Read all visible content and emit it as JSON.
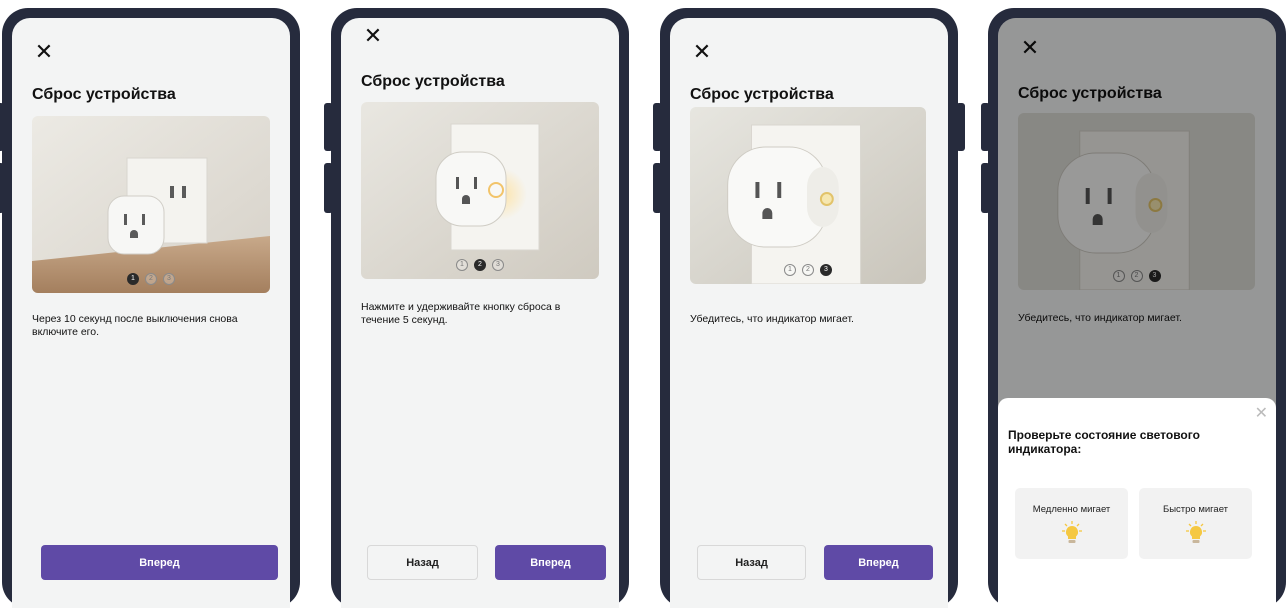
{
  "close_glyph": "✕",
  "sheet_close_glyph": "✕",
  "screens": [
    {
      "title": "Сброс устройства",
      "dots": [
        "1",
        "2",
        "3"
      ],
      "active_dot": 1,
      "description": "Через 10 секунд после выключения снова включите его.",
      "next_label": "Вперед"
    },
    {
      "title": "Сброс устройства",
      "dots": [
        "1",
        "2",
        "3"
      ],
      "active_dot": 2,
      "description": "Нажмите и удерживайте кнопку сброса в течение 5 секунд.",
      "back_label": "Назад",
      "next_label": "Вперед"
    },
    {
      "title": "Сброс устройства",
      "dots": [
        "1",
        "2",
        "3"
      ],
      "active_dot": 3,
      "description": "Убедитесь, что индикатор мигает.",
      "back_label": "Назад",
      "next_label": "Вперед"
    },
    {
      "title": "Сброс устройства",
      "dots": [
        "1",
        "2",
        "3"
      ],
      "active_dot": 3,
      "description": "Убедитесь, что индикатор мигает.",
      "sheet": {
        "title": "Проверьте состояние светового индикатора:",
        "options": [
          {
            "label": "Медленно мигает",
            "icon": "light-bulb-icon"
          },
          {
            "label": "Быстро мигает",
            "icon": "light-bulb-icon"
          }
        ]
      }
    }
  ],
  "colors": {
    "frame": "#262b3d",
    "screen_bg": "#f3f4f4",
    "primary": "#5f4aa6",
    "bulb": "#f5c842"
  }
}
